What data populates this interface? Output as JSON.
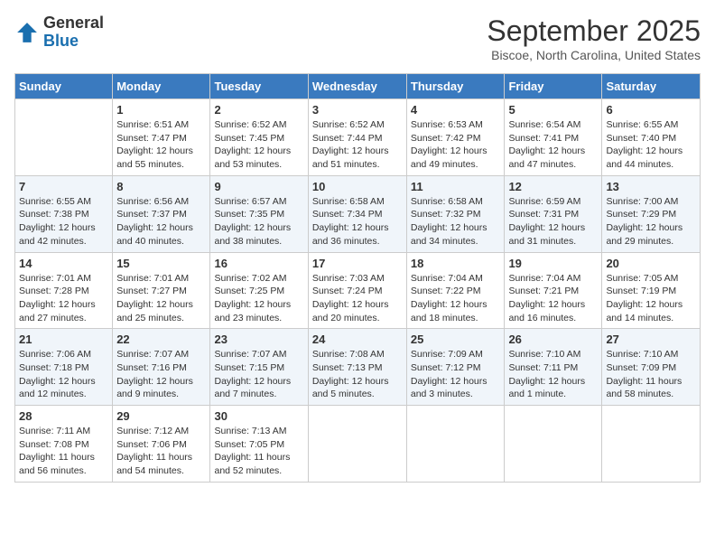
{
  "header": {
    "logo": {
      "general": "General",
      "blue": "Blue"
    },
    "title": "September 2025",
    "subtitle": "Biscoe, North Carolina, United States"
  },
  "calendar": {
    "days_of_week": [
      "Sunday",
      "Monday",
      "Tuesday",
      "Wednesday",
      "Thursday",
      "Friday",
      "Saturday"
    ],
    "weeks": [
      [
        {
          "day": "",
          "sunrise": "",
          "sunset": "",
          "daylight": ""
        },
        {
          "day": "1",
          "sunrise": "Sunrise: 6:51 AM",
          "sunset": "Sunset: 7:47 PM",
          "daylight": "Daylight: 12 hours and 55 minutes."
        },
        {
          "day": "2",
          "sunrise": "Sunrise: 6:52 AM",
          "sunset": "Sunset: 7:45 PM",
          "daylight": "Daylight: 12 hours and 53 minutes."
        },
        {
          "day": "3",
          "sunrise": "Sunrise: 6:52 AM",
          "sunset": "Sunset: 7:44 PM",
          "daylight": "Daylight: 12 hours and 51 minutes."
        },
        {
          "day": "4",
          "sunrise": "Sunrise: 6:53 AM",
          "sunset": "Sunset: 7:42 PM",
          "daylight": "Daylight: 12 hours and 49 minutes."
        },
        {
          "day": "5",
          "sunrise": "Sunrise: 6:54 AM",
          "sunset": "Sunset: 7:41 PM",
          "daylight": "Daylight: 12 hours and 47 minutes."
        },
        {
          "day": "6",
          "sunrise": "Sunrise: 6:55 AM",
          "sunset": "Sunset: 7:40 PM",
          "daylight": "Daylight: 12 hours and 44 minutes."
        }
      ],
      [
        {
          "day": "7",
          "sunrise": "Sunrise: 6:55 AM",
          "sunset": "Sunset: 7:38 PM",
          "daylight": "Daylight: 12 hours and 42 minutes."
        },
        {
          "day": "8",
          "sunrise": "Sunrise: 6:56 AM",
          "sunset": "Sunset: 7:37 PM",
          "daylight": "Daylight: 12 hours and 40 minutes."
        },
        {
          "day": "9",
          "sunrise": "Sunrise: 6:57 AM",
          "sunset": "Sunset: 7:35 PM",
          "daylight": "Daylight: 12 hours and 38 minutes."
        },
        {
          "day": "10",
          "sunrise": "Sunrise: 6:58 AM",
          "sunset": "Sunset: 7:34 PM",
          "daylight": "Daylight: 12 hours and 36 minutes."
        },
        {
          "day": "11",
          "sunrise": "Sunrise: 6:58 AM",
          "sunset": "Sunset: 7:32 PM",
          "daylight": "Daylight: 12 hours and 34 minutes."
        },
        {
          "day": "12",
          "sunrise": "Sunrise: 6:59 AM",
          "sunset": "Sunset: 7:31 PM",
          "daylight": "Daylight: 12 hours and 31 minutes."
        },
        {
          "day": "13",
          "sunrise": "Sunrise: 7:00 AM",
          "sunset": "Sunset: 7:29 PM",
          "daylight": "Daylight: 12 hours and 29 minutes."
        }
      ],
      [
        {
          "day": "14",
          "sunrise": "Sunrise: 7:01 AM",
          "sunset": "Sunset: 7:28 PM",
          "daylight": "Daylight: 12 hours and 27 minutes."
        },
        {
          "day": "15",
          "sunrise": "Sunrise: 7:01 AM",
          "sunset": "Sunset: 7:27 PM",
          "daylight": "Daylight: 12 hours and 25 minutes."
        },
        {
          "day": "16",
          "sunrise": "Sunrise: 7:02 AM",
          "sunset": "Sunset: 7:25 PM",
          "daylight": "Daylight: 12 hours and 23 minutes."
        },
        {
          "day": "17",
          "sunrise": "Sunrise: 7:03 AM",
          "sunset": "Sunset: 7:24 PM",
          "daylight": "Daylight: 12 hours and 20 minutes."
        },
        {
          "day": "18",
          "sunrise": "Sunrise: 7:04 AM",
          "sunset": "Sunset: 7:22 PM",
          "daylight": "Daylight: 12 hours and 18 minutes."
        },
        {
          "day": "19",
          "sunrise": "Sunrise: 7:04 AM",
          "sunset": "Sunset: 7:21 PM",
          "daylight": "Daylight: 12 hours and 16 minutes."
        },
        {
          "day": "20",
          "sunrise": "Sunrise: 7:05 AM",
          "sunset": "Sunset: 7:19 PM",
          "daylight": "Daylight: 12 hours and 14 minutes."
        }
      ],
      [
        {
          "day": "21",
          "sunrise": "Sunrise: 7:06 AM",
          "sunset": "Sunset: 7:18 PM",
          "daylight": "Daylight: 12 hours and 12 minutes."
        },
        {
          "day": "22",
          "sunrise": "Sunrise: 7:07 AM",
          "sunset": "Sunset: 7:16 PM",
          "daylight": "Daylight: 12 hours and 9 minutes."
        },
        {
          "day": "23",
          "sunrise": "Sunrise: 7:07 AM",
          "sunset": "Sunset: 7:15 PM",
          "daylight": "Daylight: 12 hours and 7 minutes."
        },
        {
          "day": "24",
          "sunrise": "Sunrise: 7:08 AM",
          "sunset": "Sunset: 7:13 PM",
          "daylight": "Daylight: 12 hours and 5 minutes."
        },
        {
          "day": "25",
          "sunrise": "Sunrise: 7:09 AM",
          "sunset": "Sunset: 7:12 PM",
          "daylight": "Daylight: 12 hours and 3 minutes."
        },
        {
          "day": "26",
          "sunrise": "Sunrise: 7:10 AM",
          "sunset": "Sunset: 7:11 PM",
          "daylight": "Daylight: 12 hours and 1 minute."
        },
        {
          "day": "27",
          "sunrise": "Sunrise: 7:10 AM",
          "sunset": "Sunset: 7:09 PM",
          "daylight": "Daylight: 11 hours and 58 minutes."
        }
      ],
      [
        {
          "day": "28",
          "sunrise": "Sunrise: 7:11 AM",
          "sunset": "Sunset: 7:08 PM",
          "daylight": "Daylight: 11 hours and 56 minutes."
        },
        {
          "day": "29",
          "sunrise": "Sunrise: 7:12 AM",
          "sunset": "Sunset: 7:06 PM",
          "daylight": "Daylight: 11 hours and 54 minutes."
        },
        {
          "day": "30",
          "sunrise": "Sunrise: 7:13 AM",
          "sunset": "Sunset: 7:05 PM",
          "daylight": "Daylight: 11 hours and 52 minutes."
        },
        {
          "day": "",
          "sunrise": "",
          "sunset": "",
          "daylight": ""
        },
        {
          "day": "",
          "sunrise": "",
          "sunset": "",
          "daylight": ""
        },
        {
          "day": "",
          "sunrise": "",
          "sunset": "",
          "daylight": ""
        },
        {
          "day": "",
          "sunrise": "",
          "sunset": "",
          "daylight": ""
        }
      ]
    ]
  }
}
